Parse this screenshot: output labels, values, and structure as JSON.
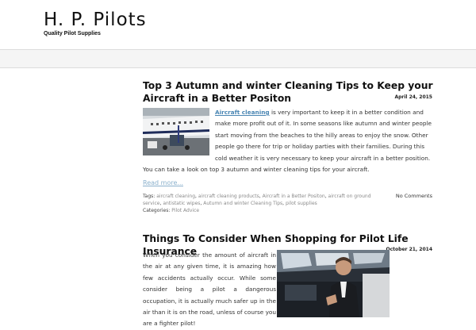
{
  "site": {
    "title": "H. P. Pilots",
    "tagline": "Quality Pilot Supplies"
  },
  "posts": [
    {
      "title": "Top 3 Autumn and winter Cleaning Tips to Keep your Aircraft in a Better Positon",
      "date": "April 24, 2015",
      "link_text": "Aircraft cleaning",
      "excerpt_rest": " is very important to keep it in a better condition and make more profit out of it. In some seasons like autumn and winter people start moving from the beaches to the hilly areas to enjoy the snow. Other people go there for trip or holiday parties with their families. During this cold weather it is very necessary to keep your aircraft in a better position. You can take a look on top 3 autumn and winter cleaning tips for your aircraft.",
      "read_more": "Read more...",
      "tags_label": "Tags:",
      "tags": [
        "aircraft cleaning",
        "aircraft cleaning products",
        "Aircraft in a Better Positon",
        "aircraft on ground service",
        "antistatic wipes",
        "Autumn and winter Cleaning Tips",
        "pilot supplies"
      ],
      "categories_label": "Categories:",
      "categories": [
        "Pilot Advice"
      ],
      "comments": "No Comments"
    },
    {
      "title": "Things To Consider When Shopping for Pilot Life Insurance",
      "date": "October 21, 2014",
      "excerpt": "When you consider the amount of aircraft in the air at any given time, it is amazing how few accidents actually occur. While some consider being a pilot a dangerous occupation, it is actually much safer up in the air than it is on the road, unless of course you are a fighter pilot!"
    }
  ],
  "colors": {
    "link": "#4a86b3",
    "read_more": "#8ab0cc",
    "meta_link": "#8a8a8a"
  }
}
